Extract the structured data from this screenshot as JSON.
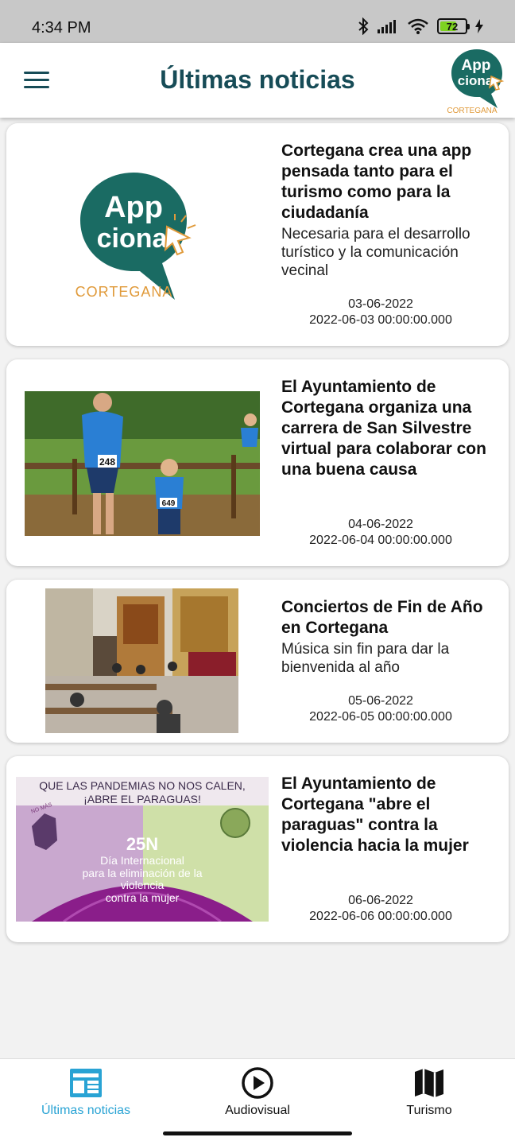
{
  "status_bar": {
    "time": "4:34 PM",
    "battery": "72",
    "battery_level": 0.72
  },
  "app_bar": {
    "title": "Últimas noticias",
    "logo_word_1": "App",
    "logo_word_2": "ciona",
    "logo_town": "CORTEGANA"
  },
  "articles": [
    {
      "headline": "Cortegana crea una app pensada tanto para el turismo como para la ciudadanía",
      "subtitle": "Necesaria para el desarrollo turístico y la comunicación vecinal",
      "date": "03-06-2022",
      "timestamp": "2022-06-03 00:00:00.000",
      "image": "appciona-logo"
    },
    {
      "headline": "El Ayuntamiento de Cortegana organiza una carrera de San Silvestre virtual para colaborar con una buena causa",
      "subtitle": "",
      "date": "04-06-2022",
      "timestamp": "2022-06-04 00:00:00.000",
      "image": "runners-photo",
      "bib_1": "248",
      "bib_2": "649"
    },
    {
      "headline": "Conciertos de Fin de Año en Cortegana",
      "subtitle": "Música sin fin para dar la bienvenida al año",
      "date": "05-06-2022",
      "timestamp": "2022-06-05 00:00:00.000",
      "image": "church-concert-photo"
    },
    {
      "headline": "El Ayuntamiento de Cortegana \"abre el paraguas\" contra la violencia hacia la mujer",
      "subtitle": "",
      "date": "06-06-2022",
      "timestamp": "2022-06-06 00:00:00.000",
      "image": "25n-poster",
      "poster_line_1": "QUE LAS PANDEMIAS NO NOS CALEN,",
      "poster_line_2": "¡ABRE EL PARAGUAS!",
      "poster_big": "25N",
      "poster_line_3": "Día Internacional",
      "poster_line_4": "para la eliminación de la",
      "poster_line_5": "violencia",
      "poster_line_6": "contra la mujer",
      "poster_stamp": "NO MÁS"
    }
  ],
  "bottom_nav": [
    {
      "label": "Últimas noticias",
      "icon": "newspaper-icon",
      "active": true
    },
    {
      "label": "Audiovisual",
      "icon": "play-circle-icon",
      "active": false
    },
    {
      "label": "Turismo",
      "icon": "map-icon",
      "active": false
    }
  ],
  "colors": {
    "brand_teal": "#1a6b63",
    "title_teal": "#174c57",
    "accent_orange": "#e09a3a",
    "nav_active": "#29a3d4"
  }
}
